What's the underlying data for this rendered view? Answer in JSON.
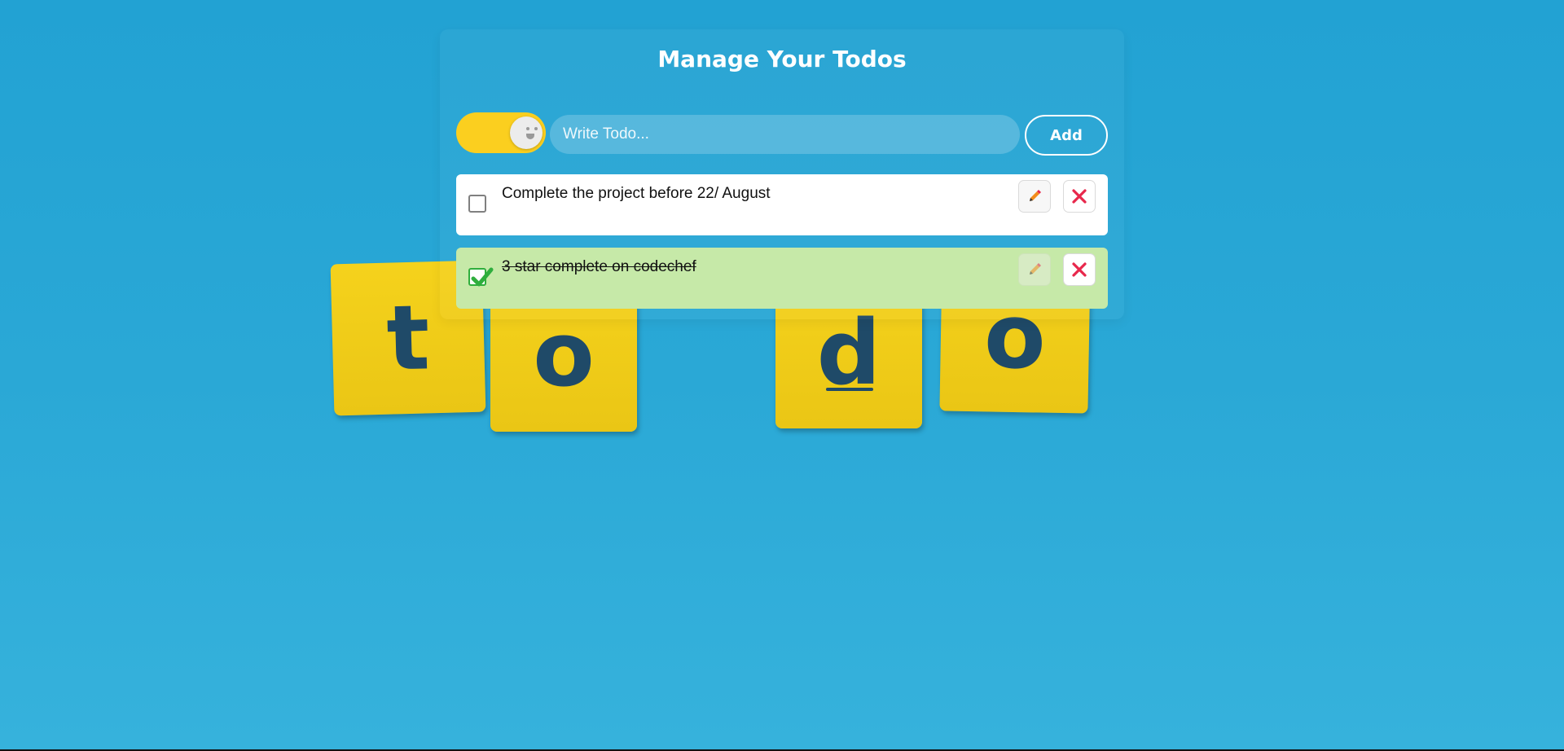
{
  "header": {
    "title": "Manage Your Todos"
  },
  "theme_toggle": {
    "state": "on",
    "track_color": "#fbcf1f"
  },
  "form": {
    "input_value": "",
    "input_placeholder": "Write Todo...",
    "add_label": "Add"
  },
  "todos": [
    {
      "text": "Complete the project before 22/ August",
      "completed": false,
      "background": "#ffffff",
      "edit_icon": "pencil-icon",
      "delete_icon": "close-icon"
    },
    {
      "text": "3 star complete on codechef",
      "completed": true,
      "background": "#c6e9a8",
      "edit_icon": "pencil-icon",
      "delete_icon": "close-icon"
    }
  ],
  "background": {
    "color": "#28a6d4",
    "tiles": [
      "t",
      "o",
      "d",
      "o"
    ],
    "tile_color": "#f5d21c",
    "letter_color": "#1f4a68"
  },
  "colors": {
    "edit_icon": "#f28c1c",
    "delete_icon": "#e8274b",
    "check_icon": "#2fae3d"
  }
}
